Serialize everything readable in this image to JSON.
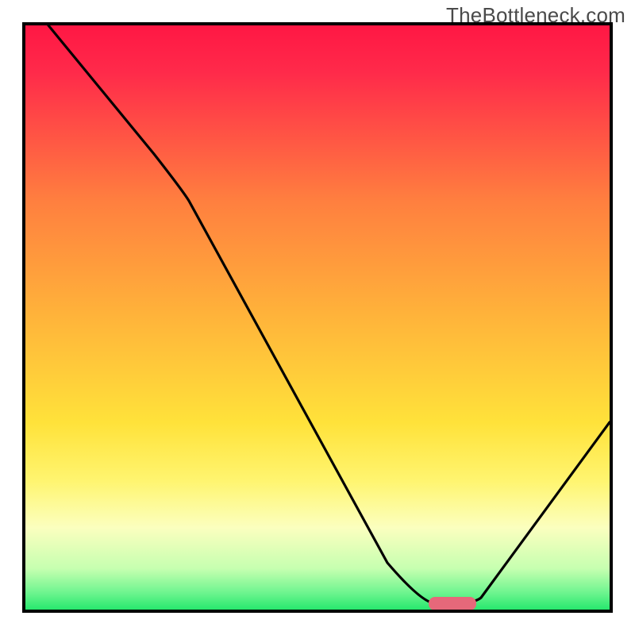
{
  "watermark": "TheBottleneck.com",
  "chart_data": {
    "type": "line",
    "title": "",
    "xlabel": "",
    "ylabel": "",
    "xlim": [
      0,
      100
    ],
    "ylim": [
      0,
      100
    ],
    "axes_visible": false,
    "legend_visible": false,
    "background": {
      "type": "vertical-gradient",
      "stops": [
        {
          "pos": 0.0,
          "color": "#ff1744"
        },
        {
          "pos": 0.08,
          "color": "#ff2a4a"
        },
        {
          "pos": 0.3,
          "color": "#ff7f3f"
        },
        {
          "pos": 0.5,
          "color": "#ffb43a"
        },
        {
          "pos": 0.68,
          "color": "#ffe23a"
        },
        {
          "pos": 0.78,
          "color": "#fff570"
        },
        {
          "pos": 0.86,
          "color": "#fbffbf"
        },
        {
          "pos": 0.93,
          "color": "#c6ffb0"
        },
        {
          "pos": 0.97,
          "color": "#70f590"
        },
        {
          "pos": 1.0,
          "color": "#27e86e"
        }
      ]
    },
    "curve": {
      "description": "V-shaped curve descending from top-left, flattening briefly near the minimum, then rising toward the right edge",
      "points_xy": [
        [
          4,
          100
        ],
        [
          22,
          78
        ],
        [
          28,
          70
        ],
        [
          62,
          8
        ],
        [
          70,
          1
        ],
        [
          75,
          1
        ],
        [
          78,
          2
        ],
        [
          100,
          32
        ]
      ]
    },
    "marker": {
      "description": "Short rounded pink segment at the curve minimum",
      "center_x": 72,
      "center_y": 1,
      "width_pct": 6,
      "color": "#e6687a"
    },
    "frame": {
      "color": "#000000",
      "stroke_width": 3
    }
  }
}
